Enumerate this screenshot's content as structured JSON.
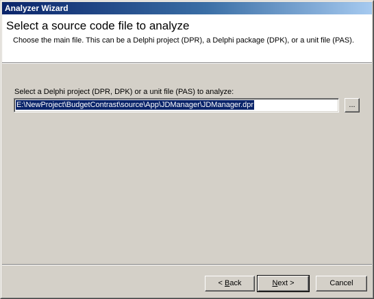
{
  "window": {
    "title": "Analyzer Wizard"
  },
  "header": {
    "heading": "Select a source code file to analyze",
    "description": "Choose the main file. This can be a Delphi project (DPR), a Delphi package (DPK), or a unit file (PAS)."
  },
  "form": {
    "label": "Select a Delphi project (DPR, DPK) or a unit file (PAS) to analyze:",
    "path_value": "E:\\NewProject\\BudgetContrast\\source\\App\\JDManager\\JDManager.dpr",
    "browse_label": "..."
  },
  "footer": {
    "back_prefix": "< ",
    "back_mnemonic": "B",
    "back_rest": "ack",
    "next_mnemonic": "N",
    "next_rest": "ext >",
    "cancel_label": "Cancel"
  },
  "colors": {
    "titlebar_start": "#0a246a",
    "titlebar_end": "#a6caf0",
    "face": "#d4d0c8",
    "selection": "#0a246a"
  }
}
